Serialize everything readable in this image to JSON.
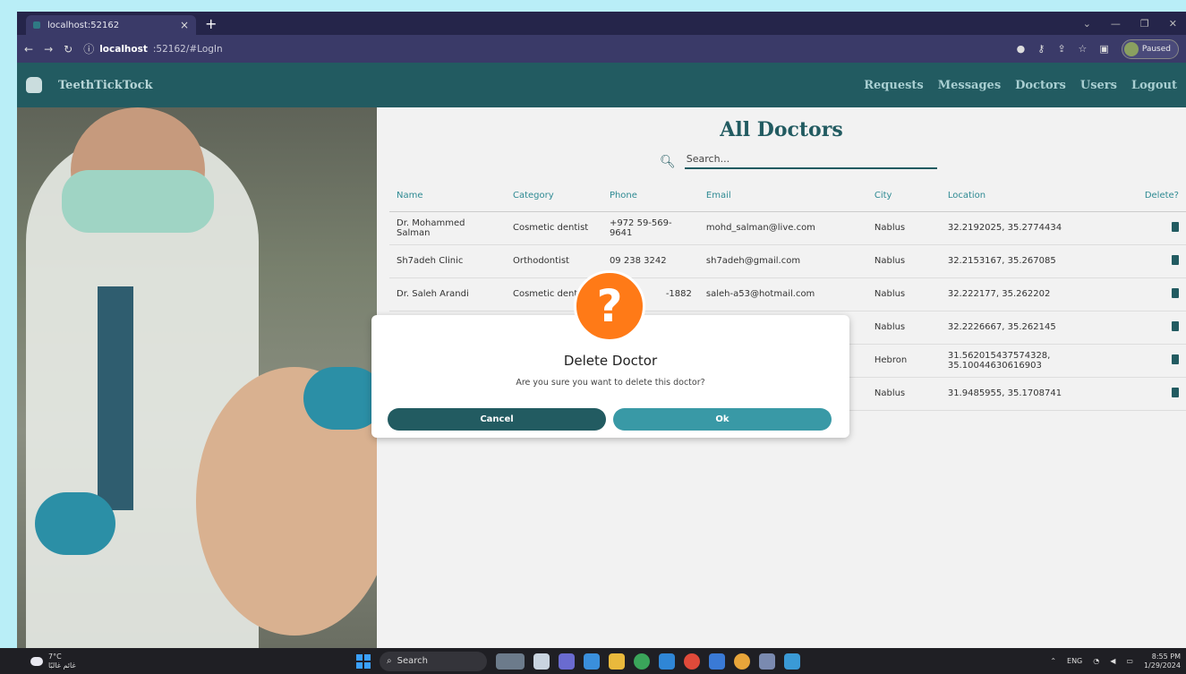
{
  "browser": {
    "tab_title": "localhost:52162",
    "tab_close": "×",
    "new_tab": "+",
    "window_controls": [
      "⌄",
      "—",
      "❐",
      "✕"
    ],
    "address_host": "localhost",
    "address_path": ":52162/#LogIn",
    "profile_status": "Paused"
  },
  "app": {
    "brand": "TeethTickTock",
    "nav": [
      "Requests",
      "Messages",
      "Doctors",
      "Users",
      "Logout"
    ]
  },
  "main": {
    "title": "All Doctors",
    "search_placeholder": "Search...",
    "columns": [
      "Name",
      "Category",
      "Phone",
      "Email",
      "City",
      "Location",
      "Delete?"
    ],
    "rows": [
      {
        "name": "Dr. Mohammed Salman",
        "category": "Cosmetic dentist",
        "phone": "+972 59-569-9641",
        "email": "mohd_salman@live.com",
        "city": "Nablus",
        "location": "32.2192025, 35.2774434"
      },
      {
        "name": "Sh7adeh Clinic",
        "category": "Orthodontist",
        "phone": "09 238 3242",
        "email": "sh7adeh@gmail.com",
        "city": "Nablus",
        "location": "32.2153167, 35.267085"
      },
      {
        "name": "Dr. Saleh Arandi",
        "category": "Cosmetic dentist",
        "phone": "-1882",
        "email": "saleh-a53@hotmail.com",
        "city": "Nablus",
        "location": "32.222177, 35.262202"
      },
      {
        "name": "",
        "category": "",
        "phone": "",
        "email": "",
        "city": "Nablus",
        "location": "32.2226667, 35.262145"
      },
      {
        "name": "",
        "category": "",
        "phone": "",
        "email": "",
        "city": "Hebron",
        "location": "31.562015437574328, 35.10044630616903"
      },
      {
        "name": "",
        "category": "",
        "phone": "",
        "email": "",
        "city": "Nablus",
        "location": "31.9485955, 35.1708741"
      }
    ]
  },
  "dialog": {
    "icon": "?",
    "title": "Delete Doctor",
    "message": "Are you sure you want to delete this doctor?",
    "cancel_label": "Cancel",
    "ok_label": "Ok"
  },
  "taskbar": {
    "temperature": "7°C",
    "weather_text": "غائم غالبًا",
    "search_label": "Search",
    "language": "ENG",
    "time": "8:55 PM",
    "date": "1/29/2024"
  },
  "colors": {
    "primary": "#225b61",
    "accent": "#3999a6",
    "warning": "#ff7a17"
  }
}
